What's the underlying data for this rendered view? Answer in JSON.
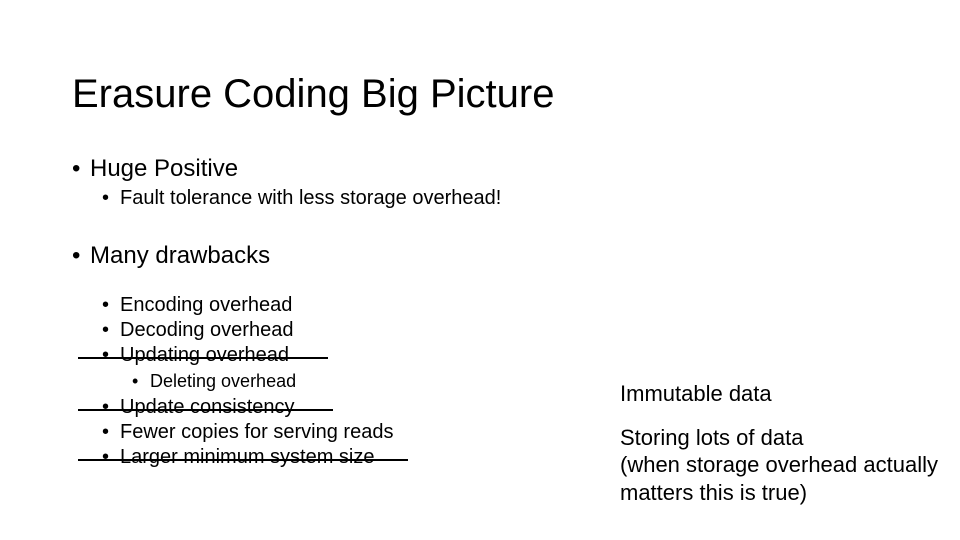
{
  "title": "Erasure Coding Big Picture",
  "body": {
    "positive": {
      "heading": "Huge Positive",
      "items": [
        "Fault tolerance with less storage overhead!"
      ]
    },
    "drawbacks": {
      "heading": "Many drawbacks",
      "items": [
        {
          "text": "Encoding overhead",
          "struck": false
        },
        {
          "text": "Decoding overhead",
          "struck": false
        },
        {
          "text": "Updating overhead",
          "struck": true,
          "strike_width": 250
        },
        {
          "text": "Deleting overhead",
          "struck": false,
          "sub": true
        },
        {
          "text": "Update consistency",
          "struck": true,
          "strike_width": 255
        },
        {
          "text": "Fewer copies for serving reads",
          "struck": false
        },
        {
          "text": "Larger minimum system size",
          "struck": true,
          "strike_width": 330
        }
      ]
    }
  },
  "notes": {
    "line1": "Immutable data",
    "line2": "Storing lots of data",
    "line3": "(when storage overhead actually matters this is true)"
  }
}
